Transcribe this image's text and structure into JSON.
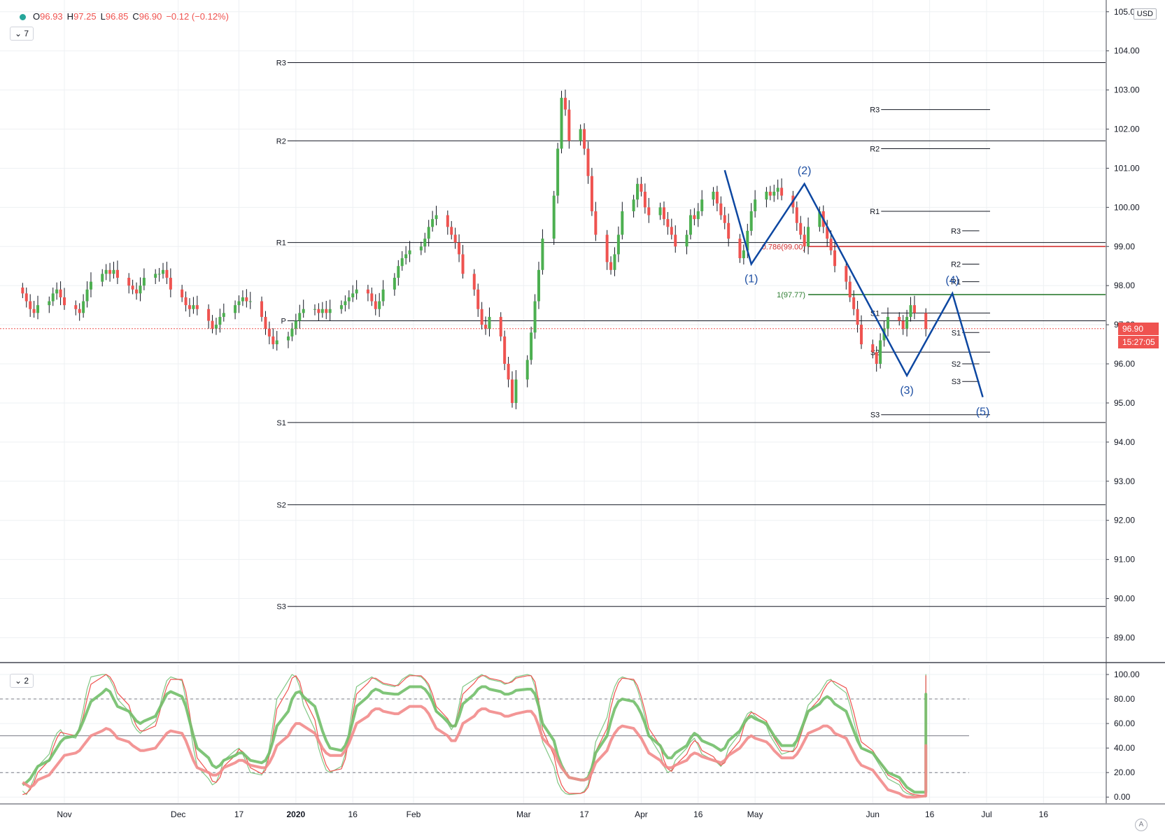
{
  "legend": {
    "o_label": "O",
    "o": "96.93",
    "h_label": "H",
    "h": "97.25",
    "l_label": "L",
    "l": "96.85",
    "c_label": "C",
    "c": "96.90",
    "change": "−0.12 (−0.12%)"
  },
  "main_pane_button": "7",
  "osc_pane_button": "2",
  "currency": "USD",
  "last_price": "96.90",
  "countdown": "15:27:05",
  "auto_button": "A",
  "colors": {
    "up": "#4caf50",
    "down": "#ef5350",
    "wave": "#0d47a1",
    "wave_label": "#1e4fa3",
    "fib_0786": "#d32f2f",
    "fib_1": "#2e7d32",
    "stoch_slow_green": "#81c784",
    "stoch_slow_red": "#f28b8b"
  },
  "chart_data": [
    {
      "type": "candlestick",
      "title": "",
      "ylim": [
        88.4,
        105.3
      ],
      "y_ticks": [
        "89.00",
        "90.00",
        "91.00",
        "92.00",
        "93.00",
        "94.00",
        "95.00",
        "96.00",
        "97.00",
        "98.00",
        "99.00",
        "100.00",
        "101.00",
        "102.00",
        "103.00",
        "104.00",
        "105.00"
      ],
      "x_labels": [
        "Nov",
        "Dec",
        "17",
        "2020",
        "16",
        "Feb",
        "Mar",
        "17",
        "Apr",
        "16",
        "May",
        "Jun",
        "16",
        "Jul",
        "16"
      ],
      "close_series": [
        97.8,
        97.6,
        97.4,
        97.3,
        97.5,
        97.6,
        97.8,
        97.9,
        97.7,
        97.5,
        97.4,
        97.3,
        97.6,
        97.9,
        98.1,
        98.3,
        98.4,
        98.3,
        98.4,
        98.2,
        98.0,
        97.9,
        97.8,
        98.0,
        98.2,
        98.3,
        98.3,
        98.4,
        98.2,
        97.9,
        97.7,
        97.5,
        97.4,
        97.5,
        97.4,
        97.1,
        96.9,
        97.0,
        97.2,
        97.3,
        97.5,
        97.6,
        97.7,
        97.6,
        97.6,
        97.2,
        96.9,
        96.7,
        96.5,
        96.6,
        96.7,
        96.9,
        97.1,
        97.3,
        97.4,
        97.4,
        97.3,
        97.4,
        97.3,
        97.4,
        97.5,
        97.6,
        97.7,
        97.8,
        97.9,
        97.8,
        97.6,
        97.4,
        97.6,
        97.9,
        98.2,
        98.5,
        98.7,
        98.8,
        98.9,
        99.0,
        99.2,
        99.5,
        99.7,
        99.8,
        99.5,
        99.3,
        99.1,
        98.8,
        98.3,
        97.9,
        97.4,
        97.0,
        96.9,
        97.2,
        96.7,
        96.0,
        95.6,
        95.0,
        95.6,
        96.1,
        96.8,
        97.6,
        98.4,
        99.2,
        100.3,
        101.5,
        102.8,
        102.5,
        101.7,
        102.0,
        101.5,
        100.8,
        99.9,
        99.3,
        98.6,
        98.4,
        98.8,
        99.3,
        99.9,
        100.2,
        100.6,
        100.4,
        100.0,
        99.8,
        100.0,
        99.7,
        99.5,
        99.3,
        99.0,
        99.3,
        99.8,
        99.7,
        99.9,
        100.2,
        100.4,
        100.1,
        99.8,
        99.6,
        99.2,
        98.7,
        98.9,
        99.4,
        99.9,
        100.2,
        100.4,
        100.3,
        100.4,
        100.5,
        100.3,
        100.0,
        99.6,
        99.3,
        99.0,
        99.5,
        99.9,
        99.5,
        99.2,
        98.9,
        98.5,
        98.1,
        97.7,
        97.4,
        97.0,
        96.5,
        96.3,
        96.0,
        96.6,
        96.9,
        97.2,
        97.1,
        96.9,
        97.2,
        97.5,
        97.3,
        96.9
      ],
      "pivots_long": {
        "P": 97.1,
        "R1": 99.1,
        "R2": 101.7,
        "R3": 103.7,
        "S1": 94.5,
        "S2": 92.4,
        "S3": 89.8
      },
      "pivots_mid": {
        "R3": 102.5,
        "R2": 101.5,
        "R1": 99.9,
        "S1": 97.3,
        "S2": 96.3,
        "S3": 94.7
      },
      "pivots_short": {
        "R3": 99.4,
        "R2": 98.55,
        "R1": 98.1,
        "S1": 96.8,
        "S2": 96.0,
        "S3": 95.55
      },
      "fib_levels": [
        {
          "label": "0.786(99.00)",
          "value": 99.0
        },
        {
          "label": "1(97.77)",
          "value": 97.77
        }
      ],
      "last_price": 96.9,
      "elliott_wave": {
        "labels": [
          "(1)",
          "(2)",
          "(3)",
          "(4)",
          "(5)"
        ],
        "points": [
          {
            "date": "2020-04-23",
            "value": 100.95
          },
          {
            "date": "2020-04-30",
            "value": 98.55
          },
          {
            "date": "2020-05-14",
            "value": 100.6
          },
          {
            "date": "2020-06-10",
            "value": 95.7
          },
          {
            "date": "2020-06-22",
            "value": 97.8
          },
          {
            "date": "2020-06-30",
            "value": 95.15
          }
        ]
      }
    },
    {
      "type": "line",
      "title": "",
      "ylim": [
        -5,
        108
      ],
      "y_ticks": [
        "0.00",
        "20.00",
        "40.00",
        "60.00",
        "80.00",
        "100.00"
      ],
      "bands": [
        20,
        50,
        80
      ],
      "series": [
        {
          "name": "",
          "color": "#81c784",
          "width": 1.2,
          "values": [
            5,
            2,
            8,
            15,
            25,
            35,
            45,
            52,
            55,
            50,
            48,
            58,
            72,
            88,
            98,
            100,
            100,
            96,
            90,
            80,
            70,
            60,
            55,
            52,
            55,
            62,
            72,
            85,
            95,
            98,
            95,
            80,
            60,
            40,
            25,
            15,
            10,
            12,
            20,
            30,
            38,
            40,
            35,
            28,
            20,
            18,
            25,
            40,
            60,
            80,
            95,
            100,
            98,
            90,
            75,
            55,
            40,
            30,
            22,
            20,
            25,
            35,
            55,
            75,
            90,
            96,
            98,
            96,
            94,
            92,
            90,
            92,
            96,
            98,
            100,
            98,
            95,
            90,
            80,
            70,
            60,
            55,
            60,
            75,
            90,
            96,
            98,
            100,
            98,
            96,
            94,
            92,
            93,
            95,
            98,
            100,
            99,
            90,
            70,
            45,
            25,
            12,
            6,
            3,
            2,
            3,
            5,
            10,
            25,
            45,
            65,
            80,
            90,
            96,
            98,
            95,
            88,
            78,
            65,
            50,
            35,
            25,
            20,
            22,
            30,
            40,
            45,
            48,
            42,
            35,
            30,
            28,
            25,
            30,
            40,
            52,
            62,
            68,
            70,
            66,
            58,
            50,
            45,
            40,
            35,
            38,
            45,
            55,
            65,
            75,
            85,
            90,
            95,
            96,
            92,
            85,
            75,
            62,
            50,
            40,
            35,
            30,
            25,
            20,
            15,
            10,
            5,
            3,
            2,
            1,
            0,
            1,
            5,
            15,
            30,
            50,
            70,
            85,
            95,
            100,
            98,
            90,
            82
          ]
        },
        {
          "name": "",
          "color": "#ef5350",
          "width": 1.2,
          "values": [
            2,
            3,
            6,
            12,
            20,
            30,
            40,
            48,
            53,
            52,
            50,
            55,
            66,
            80,
            92,
            98,
            100,
            98,
            93,
            85,
            75,
            65,
            58,
            54,
            54,
            58,
            68,
            80,
            90,
            96,
            96,
            86,
            68,
            48,
            32,
            20,
            13,
            12,
            16,
            25,
            34,
            39,
            37,
            31,
            24,
            19,
            22,
            34,
            52,
            72,
            88,
            97,
            99,
            94,
            82,
            63,
            47,
            35,
            26,
            21,
            23,
            31,
            48,
            68,
            84,
            93,
            97,
            97,
            95,
            93,
            91,
            91,
            94,
            97,
            99,
            99,
            96,
            92,
            84,
            74,
            64,
            58,
            58,
            70,
            84,
            93,
            97,
            99,
            99,
            97,
            95,
            93,
            93,
            94,
            97,
            99,
            99,
            94,
            78,
            55,
            34,
            19,
            10,
            5,
            3,
            3,
            4,
            8,
            19,
            37,
            56,
            73,
            85,
            93,
            97,
            96,
            91,
            82,
            70,
            56,
            42,
            30,
            23,
            21,
            26,
            35,
            42,
            46,
            44,
            38,
            33,
            29,
            26,
            28,
            35,
            46,
            57,
            65,
            69,
            68,
            62,
            54,
            48,
            43,
            38,
            37,
            41,
            50,
            60,
            70,
            80,
            87,
            92,
            95,
            94,
            89,
            80,
            69,
            56,
            45,
            38,
            33,
            28,
            23,
            18,
            13,
            8,
            5,
            3,
            2,
            1,
            1,
            3,
            10,
            23,
            40,
            60,
            78,
            90,
            97,
            99,
            95,
            90
          ]
        },
        {
          "name": "",
          "color": "#72bf6a",
          "width": 4,
          "values": [
            10,
            12,
            15,
            20,
            25,
            30,
            35,
            40,
            45,
            48,
            50,
            55,
            62,
            70,
            78,
            85,
            88,
            86,
            80,
            74,
            70,
            66,
            62,
            60,
            62,
            66,
            72,
            78,
            84,
            86,
            82,
            74,
            62,
            50,
            40,
            32,
            26,
            24,
            26,
            30,
            34,
            36,
            36,
            33,
            30,
            28,
            30,
            36,
            46,
            58,
            70,
            80,
            85,
            86,
            82,
            74,
            64,
            54,
            46,
            40,
            38,
            42,
            50,
            62,
            74,
            82,
            86,
            88,
            87,
            85,
            84,
            84,
            86,
            88,
            90,
            90,
            88,
            84,
            78,
            70,
            62,
            58,
            58,
            66,
            76,
            84,
            88,
            90,
            90,
            88,
            86,
            84,
            84,
            85,
            87,
            88,
            88,
            84,
            74,
            60,
            46,
            34,
            26,
            20,
            16,
            14,
            14,
            16,
            24,
            36,
            50,
            62,
            72,
            78,
            80,
            78,
            74,
            68,
            60,
            50,
            42,
            36,
            32,
            32,
            36,
            42,
            48,
            52,
            50,
            46,
            42,
            40,
            38,
            40,
            46,
            54,
            60,
            64,
            66,
            64,
            60,
            55,
            50,
            46,
            42,
            42,
            46,
            54,
            62,
            70,
            76,
            80,
            82,
            80,
            76,
            70,
            62,
            54,
            46,
            40,
            36,
            32,
            28,
            24,
            20,
            16,
            12,
            8,
            6,
            4,
            4,
            6,
            12,
            22,
            36,
            52,
            66,
            76,
            82,
            84,
            80,
            76
          ]
        },
        {
          "name": "",
          "color": "#f28b8b",
          "width": 4,
          "values": [
            12,
            10,
            8,
            10,
            14,
            18,
            22,
            26,
            30,
            34,
            36,
            38,
            42,
            46,
            50,
            54,
            56,
            55,
            52,
            48,
            45,
            42,
            40,
            38,
            38,
            40,
            44,
            48,
            52,
            54,
            52,
            46,
            38,
            30,
            24,
            20,
            18,
            18,
            20,
            24,
            28,
            30,
            30,
            28,
            26,
            24,
            24,
            28,
            34,
            42,
            50,
            56,
            60,
            60,
            58,
            52,
            46,
            40,
            36,
            34,
            34,
            38,
            44,
            52,
            60,
            66,
            70,
            72,
            72,
            70,
            68,
            68,
            70,
            72,
            74,
            74,
            72,
            68,
            62,
            56,
            50,
            46,
            46,
            52,
            60,
            66,
            70,
            72,
            72,
            70,
            68,
            66,
            66,
            67,
            68,
            70,
            70,
            66,
            58,
            48,
            38,
            30,
            24,
            20,
            16,
            14,
            14,
            15,
            20,
            28,
            38,
            46,
            52,
            56,
            58,
            56,
            52,
            48,
            42,
            36,
            30,
            26,
            24,
            24,
            26,
            30,
            34,
            36,
            35,
            33,
            30,
            29,
            28,
            30,
            34,
            40,
            44,
            48,
            50,
            48,
            45,
            42,
            38,
            35,
            32,
            32,
            35,
            40,
            46,
            52,
            56,
            58,
            58,
            56,
            52,
            48,
            42,
            36,
            30,
            26,
            22,
            18,
            14,
            10,
            6,
            3,
            1,
            0,
            0,
            0,
            1,
            3,
            8,
            14,
            22,
            30,
            36,
            40,
            42,
            42,
            41,
            41
          ]
        }
      ]
    }
  ]
}
